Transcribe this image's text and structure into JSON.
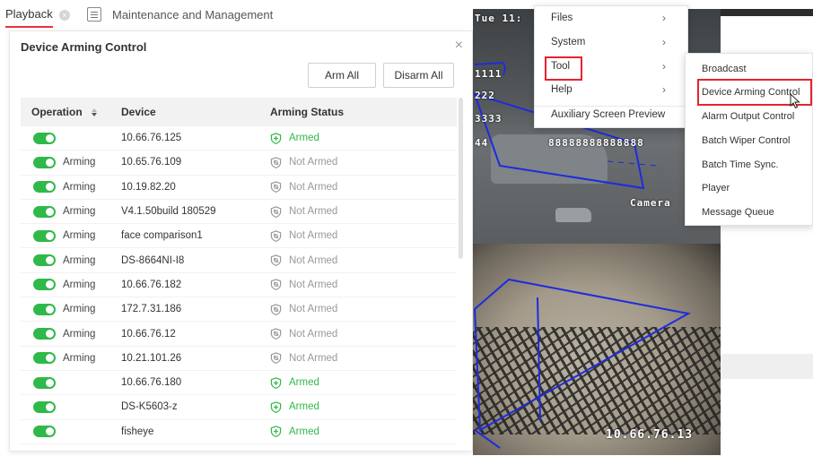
{
  "tabs": {
    "playback": "Playback",
    "close_glyph": "×",
    "maintenance": "Maintenance and Management"
  },
  "dialog": {
    "title": "Device Arming Control",
    "close_glyph": "×",
    "arm_all": "Arm All",
    "disarm_all": "Disarm All",
    "columns": {
      "operation": "Operation",
      "device": "Device",
      "status": "Arming Status"
    },
    "rows": [
      {
        "arming_label": "",
        "device": "10.66.76.125",
        "status": "Armed",
        "armed": true
      },
      {
        "arming_label": "Arming",
        "device": "10.65.76.109",
        "status": "Not Armed",
        "armed": false
      },
      {
        "arming_label": "Arming",
        "device": "10.19.82.20",
        "status": "Not Armed",
        "armed": false
      },
      {
        "arming_label": "Arming",
        "device": "V4.1.50build 180529",
        "status": "Not Armed",
        "armed": false
      },
      {
        "arming_label": "Arming",
        "device": "face comparison1",
        "status": "Not Armed",
        "armed": false
      },
      {
        "arming_label": "Arming",
        "device": "DS-8664NI-I8",
        "status": "Not Armed",
        "armed": false
      },
      {
        "arming_label": "Arming",
        "device": "10.66.76.182",
        "status": "Not Armed",
        "armed": false
      },
      {
        "arming_label": "Arming",
        "device": "172.7.31.186",
        "status": "Not Armed",
        "armed": false
      },
      {
        "arming_label": "Arming",
        "device": "10.66.76.12",
        "status": "Not Armed",
        "armed": false
      },
      {
        "arming_label": "Arming",
        "device": "10.21.101.26",
        "status": "Not Armed",
        "armed": false
      },
      {
        "arming_label": "",
        "device": "10.66.76.180",
        "status": "Armed",
        "armed": true
      },
      {
        "arming_label": "",
        "device": "DS-K5603-z",
        "status": "Armed",
        "armed": true
      },
      {
        "arming_label": "",
        "device": "fisheye",
        "status": "Armed",
        "armed": true
      }
    ]
  },
  "video": {
    "osd_time": "Tue 11:",
    "osd_1": "1111",
    "osd_2": "222",
    "osd_3": "3333",
    "osd_4": "44",
    "osd_5": "88888888888888",
    "osd_camera": "Camera",
    "osd_ip": "10.66.76.13"
  },
  "menu": {
    "items": [
      {
        "label": "Files",
        "submenu": true
      },
      {
        "label": "System",
        "submenu": true
      },
      {
        "label": "Tool",
        "submenu": true
      },
      {
        "label": "Help",
        "submenu": true
      },
      {
        "label": "Auxiliary Screen Preview",
        "submenu": false
      }
    ],
    "chevron": "›"
  },
  "tool_menu": {
    "items": [
      "Broadcast",
      "Device Arming Control",
      "Alarm Output Control",
      "Batch Wiper Control",
      "Batch Time Sync.",
      "Player",
      "Message Queue"
    ]
  },
  "colors": {
    "accent_red": "#e6232f",
    "toggle_green": "#2fb94a",
    "overlay_blue": "#1f2bdc"
  },
  "icons": {
    "armed": "shield-check-icon",
    "not_armed": "shield-off-icon",
    "maintenance": "maintenance-icon",
    "sort": "sort-icon",
    "cursor": "mouse-pointer-icon"
  }
}
